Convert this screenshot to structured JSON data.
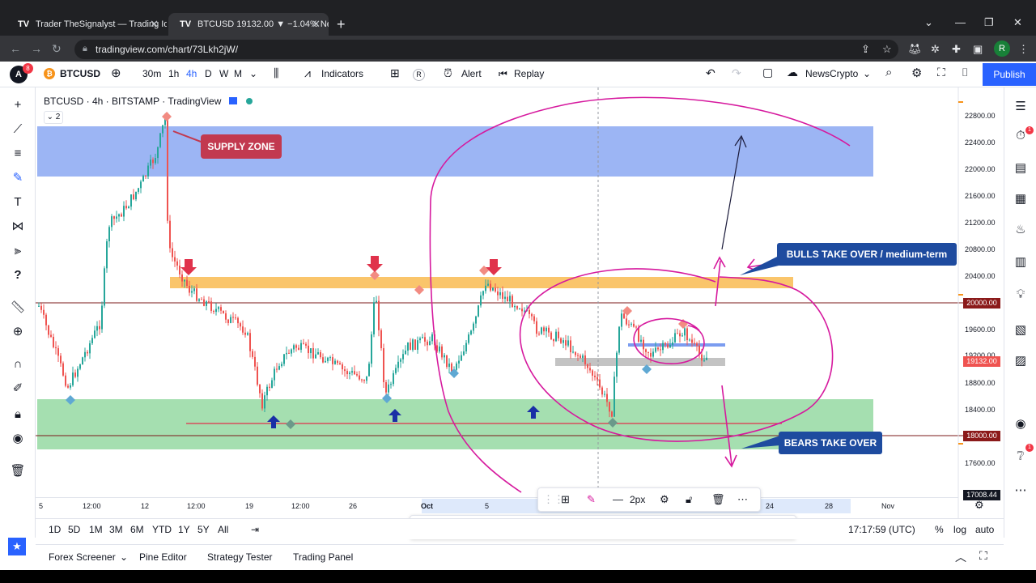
{
  "browser": {
    "tabs": [
      {
        "title": "Trader TheSignalyst — Trading Id"
      },
      {
        "title": "BTCUSD 19132.00 ▼ −1.04% Ne"
      }
    ],
    "url": "tradingview.com/chart/73Lkh2jW/",
    "profile_initial": "R"
  },
  "toolbar": {
    "logo_badge": "8",
    "symbol": "BTCUSD",
    "timeframes": [
      "30m",
      "1h",
      "4h",
      "D",
      "W",
      "M"
    ],
    "active_timeframe": "4h",
    "indicators_label": "Indicators",
    "alert_label": "Alert",
    "replay_label": "Replay",
    "layout_name": "NewsCrypto",
    "publish_label": "Publish",
    "r_label": "R"
  },
  "chart": {
    "legend": "BTCUSD · 4h · BITSTAMP · TradingView",
    "collapse_count": "2",
    "annotations": {
      "supply": "SUPPLY ZONE",
      "bulls": "BULLS TAKE OVER / medium-term",
      "bears": "BEARS TAKE OVER"
    },
    "price_tags": {
      "level_20000": "20000.00",
      "current": "19132.00",
      "level_18000": "18000.00",
      "bottom": "17008.44"
    },
    "colors": {
      "supply_zone": "#7b9cf0",
      "demand_zone": "#7fd28f",
      "resistance_zone": "#f8b13a",
      "marker": "#d6199e",
      "up": "#26a69a",
      "down": "#ef5350"
    },
    "y_axis": [
      "22800.00",
      "22400.00",
      "22000.00",
      "21600.00",
      "21200.00",
      "20800.00",
      "20400.00",
      "19600.00",
      "19200.00",
      "18800.00",
      "18400.00",
      "17600.00"
    ],
    "x_axis": [
      "5",
      "12:00",
      "12",
      "12:00",
      "19",
      "12:00",
      "26",
      "Oct",
      "5",
      "24",
      "28",
      "Nov"
    ]
  },
  "draw_toolbar": {
    "width_label": "2px"
  },
  "range_bar": {
    "ranges": [
      "1D",
      "5D",
      "1M",
      "3M",
      "6M",
      "YTD",
      "1Y",
      "5Y",
      "All"
    ],
    "clock": "17:17:59 (UTC)",
    "percent": "%",
    "log": "log",
    "auto": "auto"
  },
  "panels": [
    "Forex Screener",
    "Pine Editor",
    "Strategy Tester",
    "Trading Panel"
  ],
  "right_badges": [
    "1",
    "1"
  ]
}
